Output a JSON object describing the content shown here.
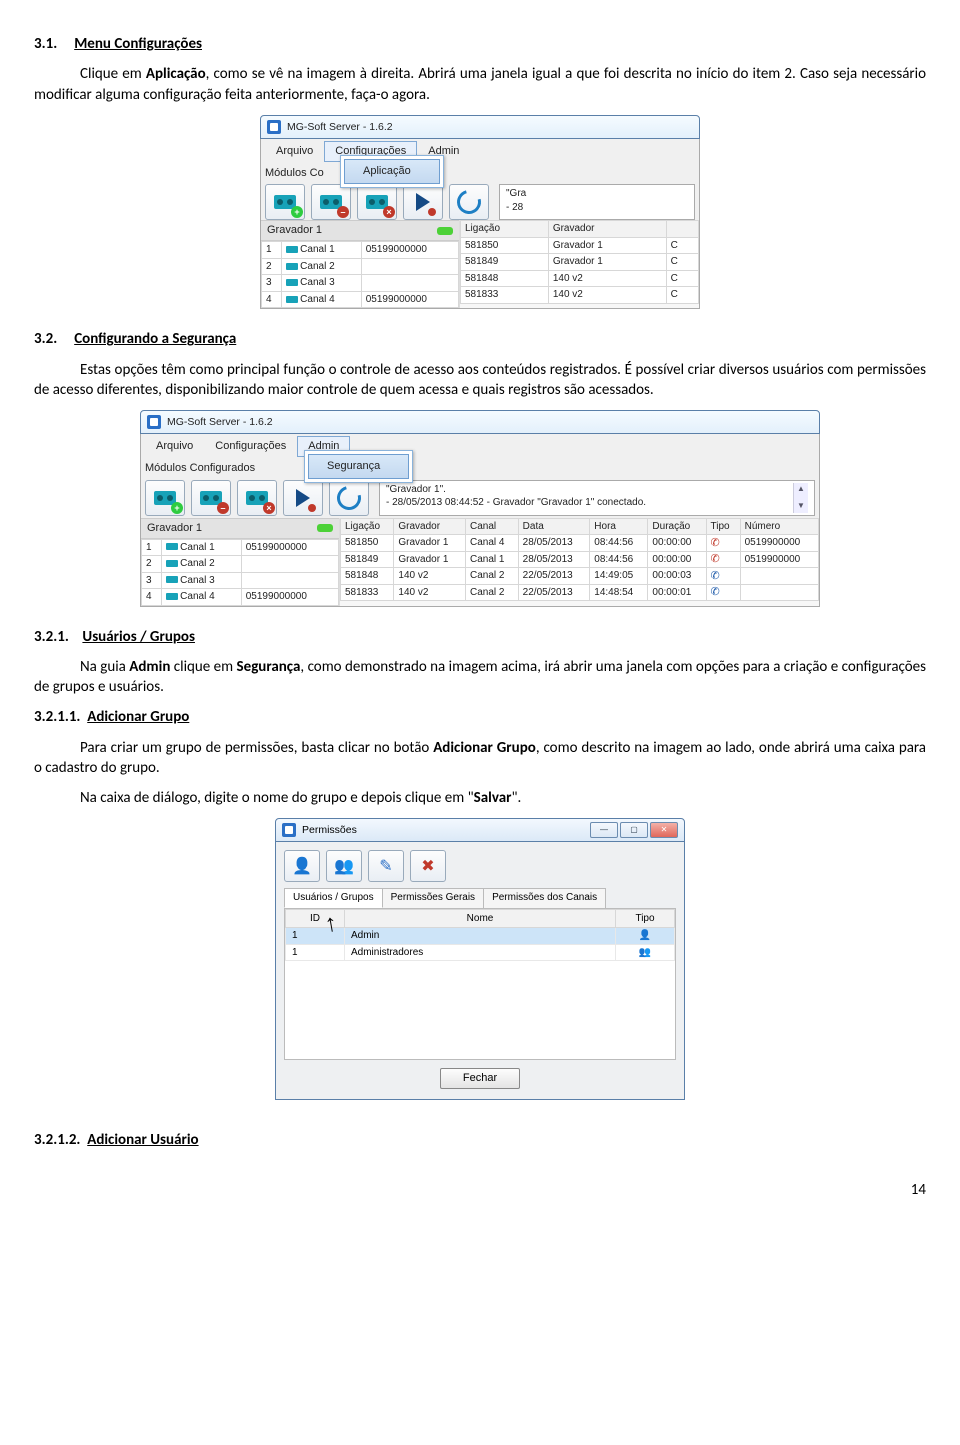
{
  "sections": {
    "s31_num": "3.1.",
    "s31_title": "Menu Configurações",
    "s31_p1a": "Clique em ",
    "s31_p1_bold1": "Aplicação",
    "s31_p1b": ", como se vê na imagem à direita. Abrirá uma janela igual a que foi descrita no início do item 2. Caso seja necessário modificar alguma configuração feita anteriormente, faça-o agora.",
    "s32_num": "3.2.",
    "s32_title": "Configurando a Segurança",
    "s32_p1": "Estas opções têm como principal função o controle de acesso aos conteúdos registrados. É possível criar diversos usuários com permissões de acesso diferentes, disponibilizando maior controle de quem acessa e quais registros são acessados.",
    "s321_num": "3.2.1.",
    "s321_title": "Usuários / Grupos",
    "s321_p1a": "Na guia ",
    "s321_p1_bold1": "Admin",
    "s321_p1b": " clique em ",
    "s321_p1_bold2": "Segurança",
    "s321_p1c": ", como demonstrado na imagem acima, irá abrir uma janela com opções para a criação e configurações de grupos e usuários.",
    "s3211_num": "3.2.1.1.",
    "s3211_title": "Adicionar Grupo",
    "s3211_p1a": "Para criar um grupo de permissões, basta clicar no botão ",
    "s3211_p1_bold1": "Adicionar Grupo",
    "s3211_p1b": ", como descrito na imagem ao lado, onde abrirá uma caixa para o cadastro do grupo.",
    "s3211_p2a": "Na caixa de diálogo, digite o nome do grupo e depois clique em \"",
    "s3211_p2_bold1": "Salvar",
    "s3211_p2b": "\".",
    "s3212_num": "3.2.1.2.",
    "s3212_title": "Adicionar Usuário"
  },
  "ss1": {
    "title": "MG-Soft Server - 1.6.2",
    "menu": {
      "arquivo": "Arquivo",
      "config": "Configurações",
      "admin": "Admin"
    },
    "submenu": {
      "aplicacao": "Aplicação"
    },
    "modules_label": "Módulos Co",
    "status1": "\"Gra",
    "status2": "- 28",
    "gravador_label": "Gravador 1",
    "left_cols": {
      "n": "",
      "ch": "",
      "num": ""
    },
    "left_rows": [
      {
        "n": "1",
        "ch": "Canal 1",
        "num": "05199000000"
      },
      {
        "n": "2",
        "ch": "Canal 2",
        "num": ""
      },
      {
        "n": "3",
        "ch": "Canal 3",
        "num": ""
      },
      {
        "n": "4",
        "ch": "Canal 4",
        "num": "05199000000"
      }
    ],
    "right_cols": {
      "ligacao": "Ligação",
      "gravador": "Gravador"
    },
    "right_rows": [
      {
        "lig": "581850",
        "grav": "Gravador 1",
        "c": "C"
      },
      {
        "lig": "581849",
        "grav": "Gravador 1",
        "c": "C"
      },
      {
        "lig": "581848",
        "grav": "140 v2",
        "c": "C"
      },
      {
        "lig": "581833",
        "grav": "140 v2",
        "c": "C"
      }
    ]
  },
  "ss2": {
    "title": "MG-Soft Server - 1.6.2",
    "menu": {
      "arquivo": "Arquivo",
      "config": "Configurações",
      "admin": "Admin"
    },
    "submenu": {
      "seguranca": "Segurança"
    },
    "modules_label": "Módulos Configurados",
    "status1": "\"Gravador 1\".",
    "status2": "- 28/05/2013 08:44:52 - Gravador \"Gravador 1\" conectado.",
    "gravador_label": "Gravador 1",
    "left_rows": [
      {
        "n": "1",
        "ch": "Canal 1",
        "num": "05199000000"
      },
      {
        "n": "2",
        "ch": "Canal 2",
        "num": ""
      },
      {
        "n": "3",
        "ch": "Canal 3",
        "num": ""
      },
      {
        "n": "4",
        "ch": "Canal 4",
        "num": "05199000000"
      }
    ],
    "right_cols": {
      "ligacao": "Ligação",
      "gravador": "Gravador",
      "canal": "Canal",
      "data": "Data",
      "hora": "Hora",
      "duracao": "Duração",
      "tipo": "Tipo",
      "numero": "Número"
    },
    "right_rows": [
      {
        "lig": "581850",
        "grav": "Gravador 1",
        "can": "Canal 4",
        "data": "28/05/2013",
        "hora": "08:44:56",
        "dur": "00:00:00",
        "tipo": "in",
        "num": "0519900000"
      },
      {
        "lig": "581849",
        "grav": "Gravador 1",
        "can": "Canal 1",
        "data": "28/05/2013",
        "hora": "08:44:56",
        "dur": "00:00:00",
        "tipo": "in",
        "num": "0519900000"
      },
      {
        "lig": "581848",
        "grav": "140 v2",
        "can": "Canal 2",
        "data": "22/05/2013",
        "hora": "14:49:05",
        "dur": "00:00:03",
        "tipo": "out",
        "num": ""
      },
      {
        "lig": "581833",
        "grav": "140 v2",
        "can": "Canal 2",
        "data": "22/05/2013",
        "hora": "14:48:54",
        "dur": "00:00:01",
        "tipo": "out",
        "num": ""
      }
    ]
  },
  "ss3": {
    "title": "Permissões",
    "tabs": {
      "usuarios": "Usuários / Grupos",
      "gerais": "Permissões Gerais",
      "canais": "Permissões dos Canais"
    },
    "cols": {
      "id": "ID",
      "nome": "Nome",
      "tipo": "Tipo"
    },
    "rows": [
      {
        "id": "1",
        "nome": "Admin",
        "tipo": "user"
      },
      {
        "id": "1",
        "nome": "Administradores",
        "tipo": "group"
      }
    ],
    "close": "Fechar"
  },
  "page_number": "14"
}
